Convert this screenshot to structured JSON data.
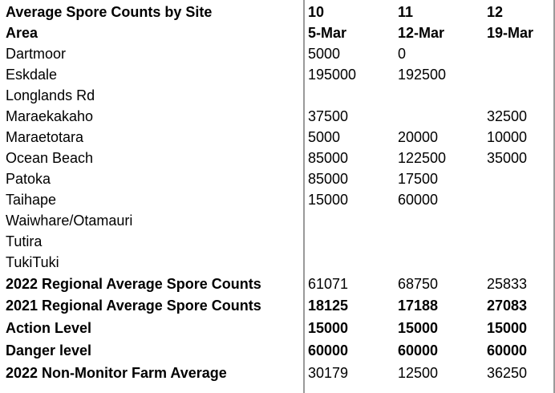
{
  "title": "Average Spore Counts by Site",
  "area_label": "Area",
  "weeks": [
    "10",
    "11",
    "12"
  ],
  "dates": [
    "5-Mar",
    "12-Mar",
    "19-Mar"
  ],
  "sites": [
    {
      "name": "Dartmoor",
      "values": [
        "5000",
        "0",
        ""
      ]
    },
    {
      "name": "Eskdale",
      "values": [
        "195000",
        "192500",
        ""
      ]
    },
    {
      "name": "Longlands Rd",
      "values": [
        "",
        "",
        ""
      ]
    },
    {
      "name": "Maraekakaho",
      "values": [
        "37500",
        "",
        "32500"
      ]
    },
    {
      "name": "Maraetotara",
      "values": [
        "5000",
        "20000",
        "10000"
      ]
    },
    {
      "name": "Ocean Beach",
      "values": [
        "85000",
        "122500",
        "35000"
      ]
    },
    {
      "name": "Patoka",
      "values": [
        "85000",
        "17500",
        ""
      ]
    },
    {
      "name": "Taihape",
      "values": [
        "15000",
        "60000",
        ""
      ]
    },
    {
      "name": "Waiwhare/Otamauri",
      "values": [
        "",
        "",
        ""
      ]
    },
    {
      "name": "Tutira",
      "values": [
        "",
        "",
        ""
      ]
    },
    {
      "name": "TukiTuki",
      "values": [
        "",
        "",
        ""
      ]
    }
  ],
  "summary": [
    {
      "name": "2022 Regional Average Spore Counts",
      "values": [
        "61071",
        "68750",
        "25833"
      ]
    },
    {
      "name": "2021 Regional Average Spore Counts",
      "values": [
        "18125",
        "17188",
        "27083"
      ]
    },
    {
      "name": "Action Level",
      "values": [
        "15000",
        "15000",
        "15000"
      ]
    },
    {
      "name": "Danger level",
      "values": [
        "60000",
        "60000",
        "60000"
      ]
    },
    {
      "name": "2022 Non-Monitor Farm Average",
      "values": [
        "30179",
        "12500",
        "36250"
      ]
    }
  ]
}
